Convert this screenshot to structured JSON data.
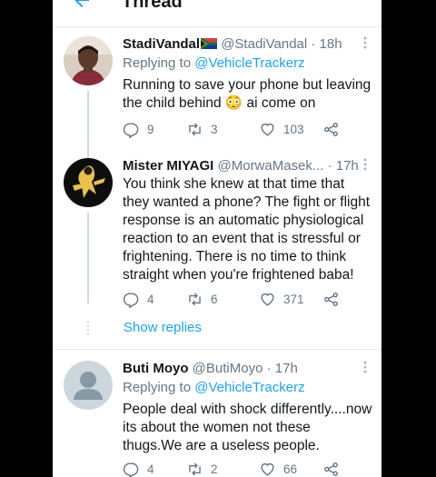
{
  "header": {
    "title": "Thread"
  },
  "tweets": [
    {
      "name": "StadiVandal",
      "handle": "@StadiVandal · 18h",
      "replying_prefix": "Replying to ",
      "replying_to": "@VehicleTrackerz",
      "text": "Running to save your phone but leaving the child behind 😳 ai come on",
      "replies": "9",
      "retweets": "3",
      "likes": "103"
    },
    {
      "name": "Mister MIYAGI",
      "handle": "@MorwaMasek... · 17h",
      "text": "You think she knew at that time that they wanted a phone? The fight or flight response is an automatic physiological reaction to an event that is stressful or frightening.  There is no time to think straight when you're frightened baba!",
      "replies": "4",
      "retweets": "6",
      "likes": "371",
      "show_replies": "Show replies"
    },
    {
      "name": "Buti Moyo",
      "handle": "@ButiMoyo · 17h",
      "replying_prefix": "Replying to ",
      "replying_to": "@VehicleTrackerz",
      "text": "People deal with shock differently....now its about the women not these thugs.We are a useless people.",
      "replies": "4",
      "retweets": "2",
      "likes": "66"
    }
  ],
  "icons": [
    "back-arrow-icon",
    "more-icon",
    "reply-icon",
    "retweet-icon",
    "like-icon",
    "share-icon",
    "south-africa-flag-icon"
  ],
  "colors": {
    "accent": "#1da1f2",
    "muted": "#657786",
    "border": "#e6ecf0"
  }
}
